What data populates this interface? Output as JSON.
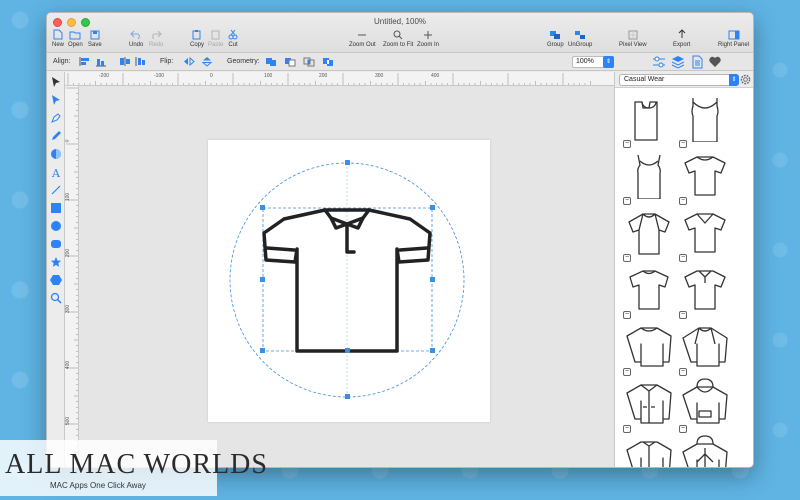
{
  "window": {
    "title": "Untitled, 100%"
  },
  "toolbar": {
    "new_label": "New",
    "open_label": "Open",
    "save_label": "Save",
    "undo_label": "Undo",
    "redo_label": "Redo",
    "copy_label": "Copy",
    "paste_label": "Paste",
    "cut_label": "Cut",
    "zoom_out_label": "Zoom Out",
    "zoom_fit_label": "Zoom to Fit",
    "zoom_in_label": "Zoom In",
    "group_label": "Group",
    "ungroup_label": "UnGroup",
    "pixel_view_label": "Pixel View",
    "export_label": "Export",
    "right_panel_label": "Right Panel"
  },
  "options": {
    "align_label": "Align:",
    "flip_label": "Flip:",
    "geometry_label": "Geometry:",
    "zoom_value": "100%"
  },
  "rulers": {
    "h_labels": [
      "-200",
      "-100",
      "0",
      "100",
      "200",
      "300",
      "400"
    ],
    "v_labels": [
      "0",
      "100",
      "200",
      "300",
      "400",
      "500"
    ]
  },
  "library": {
    "category": "Casual Wear",
    "items": [
      "t-shirt",
      "tank-top",
      "tank-top-scoop",
      "crew-tee",
      "raglan-tee",
      "v-neck-tee",
      "raglan-short",
      "polo-shirt",
      "sweatshirt",
      "raglan-sweatshirt",
      "zip-jacket",
      "hoodie",
      "track-jacket",
      "zip-hoodie"
    ]
  },
  "watermark": {
    "title": "ALL MAC WORLDS",
    "subtitle": "MAC Apps One Click Away"
  },
  "colors": {
    "accent": "#2d83f5",
    "selection": "#3d8fe0",
    "desktop": "#5fb4e4"
  }
}
